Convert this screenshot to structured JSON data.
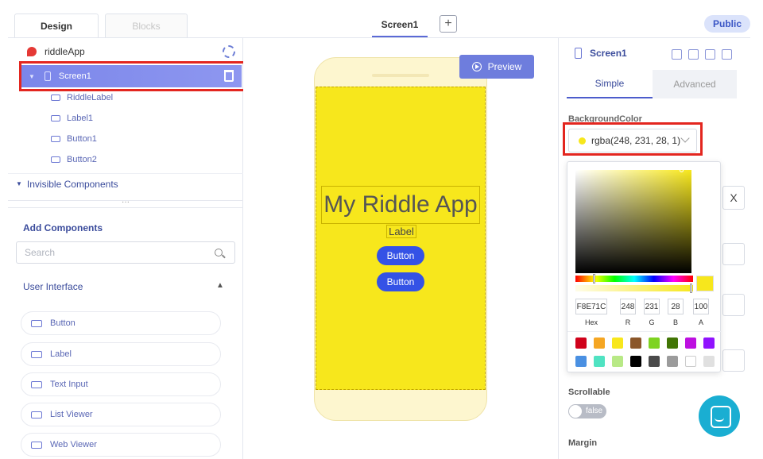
{
  "header": {
    "tabs": {
      "design": "Design",
      "blocks": "Blocks"
    },
    "screen_tab": "Screen1",
    "add_screen": "+",
    "public_label": "Public"
  },
  "tree": {
    "app_name": "riddleApp",
    "screen": "Screen1",
    "children": [
      "RiddleLabel",
      "Label1",
      "Button1",
      "Button2"
    ],
    "invisible": "Invisible Components"
  },
  "palette": {
    "title": "Add Components",
    "search_placeholder": "Search",
    "section": "User Interface",
    "items": [
      "Button",
      "Label",
      "Text Input",
      "List Viewer",
      "Web Viewer"
    ]
  },
  "canvas": {
    "preview_label": "Preview",
    "app_title": "My Riddle App",
    "label_text": "Label",
    "buttons": [
      "Button",
      "Button"
    ],
    "screen_bg": "#f7e71c"
  },
  "properties": {
    "component": "Screen1",
    "tabs": {
      "simple": "Simple",
      "advanced": "Advanced"
    },
    "bg_label": "BackgroundColor",
    "bg_value": "rgba(248, 231, 28, 1)",
    "close": "X",
    "scroll_label": "Scrollable",
    "scroll_value": "false",
    "margin_label": "Margin"
  },
  "picker": {
    "hex": "F8E71C",
    "r": "248",
    "g": "231",
    "b": "28",
    "a": "100",
    "labels": {
      "hex": "Hex",
      "r": "R",
      "g": "G",
      "b": "B",
      "a": "A"
    },
    "swatches": [
      "#d0021b",
      "#f5a623",
      "#f8e71c",
      "#8b572a",
      "#7ed321",
      "#417505",
      "#bd10e0",
      "#9013fe",
      "#4a90e2",
      "#50e3c2",
      "#b8e986",
      "#000000",
      "#4a4a4a",
      "#9b9b9b",
      "#ffffff",
      "#e0e0e0"
    ]
  }
}
